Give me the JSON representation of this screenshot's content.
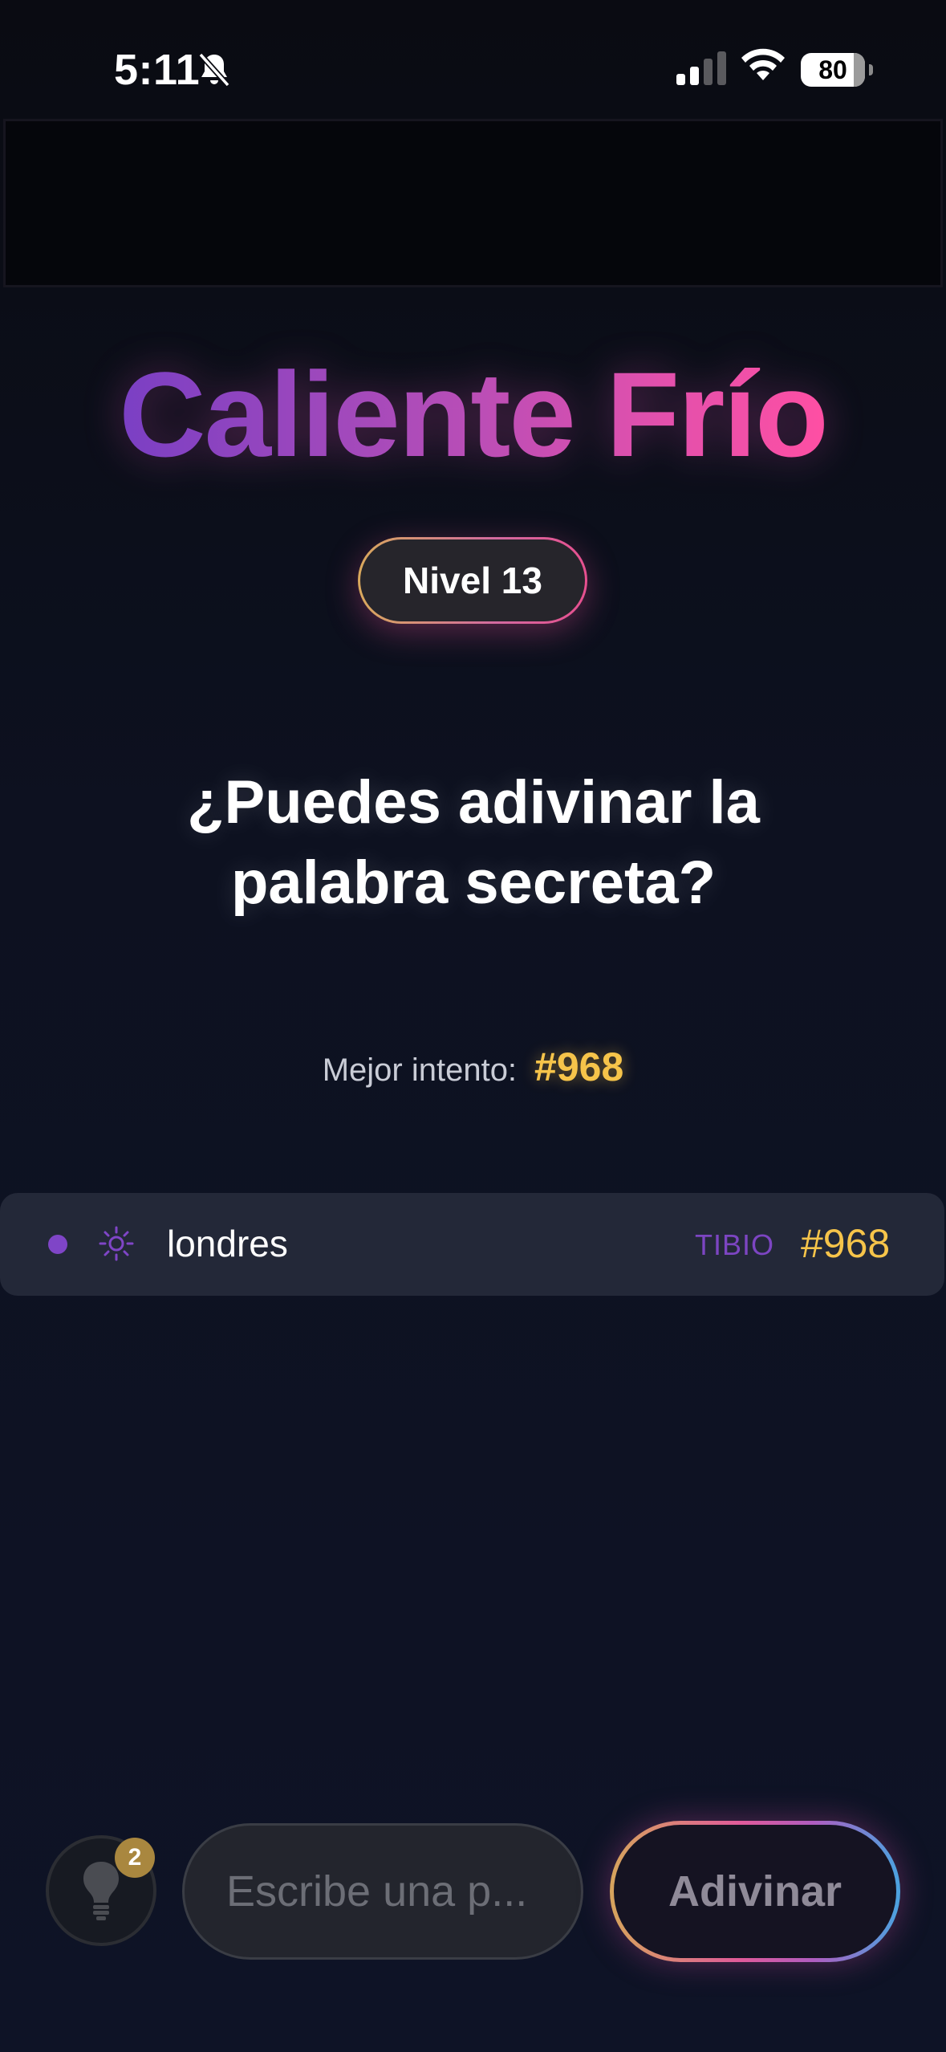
{
  "status_bar": {
    "time": "5:11",
    "battery": "80",
    "icons": [
      "bell-slash-icon",
      "cell-signal-icon",
      "wifi-icon",
      "battery-icon"
    ]
  },
  "header": {
    "title": "Caliente Frío",
    "level": "Nivel 13"
  },
  "prompt": {
    "question": "¿Puedes adivinar la palabra secreta?"
  },
  "best_attempt": {
    "label": "Mejor intento:",
    "value": "#968"
  },
  "guesses": [
    {
      "word": "londres",
      "status": "TIBIO",
      "rank": "#968",
      "icon": "sun-icon"
    }
  ],
  "footer": {
    "hints_remaining": "2",
    "input_placeholder": "Escribe una p...",
    "submit_label": "Adivinar"
  },
  "colors": {
    "accent_gold": "#f6c44a",
    "accent_purple": "#7f45c7",
    "accent_pink": "#ff4fa3",
    "row_background": "#232838"
  }
}
